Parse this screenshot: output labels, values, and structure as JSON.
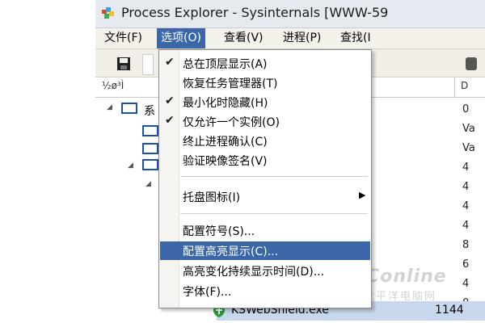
{
  "window": {
    "title": "Process Explorer - Sysinternals [WWW-59"
  },
  "menubar": {
    "items": [
      {
        "label": "文件(F)"
      },
      {
        "label": "选项(O)"
      },
      {
        "label": "查看(V)"
      },
      {
        "label": "进程(P)"
      },
      {
        "label": "查找(I"
      }
    ]
  },
  "columns": {
    "process": "½ø³Ì",
    "pid_fragment": "D"
  },
  "tree": {
    "system_label": "系",
    "pid_fragments": [
      "0",
      "Va",
      "Va",
      "4",
      "4",
      "4",
      "4",
      "8",
      "6",
      "4",
      "0"
    ]
  },
  "process_row": {
    "name": "KSWebShield.exe",
    "pid": "1144"
  },
  "watermark": {
    "main": "PConline",
    "sub": "太平洋电脑网"
  },
  "options_menu": {
    "items": [
      {
        "label": "总在顶层显示(A)",
        "checked": "✔"
      },
      {
        "label": "恢复任务管理器(T)",
        "checked": ""
      },
      {
        "label": "最小化时隐藏(H)",
        "checked": "✔"
      },
      {
        "label": "仅允许一个实例(O)",
        "checked": "✔"
      },
      {
        "label": "终止进程确认(C)",
        "checked": ""
      },
      {
        "label": "验证映像签名(V)",
        "checked": ""
      },
      {
        "label": "托盘图标(I)",
        "checked": "",
        "submenu": "▶"
      },
      {
        "label": "配置符号(S)...",
        "checked": ""
      },
      {
        "label": "配置高亮显示(C)...",
        "checked": ""
      },
      {
        "label": "高亮变化持续显示时间(D)...",
        "checked": ""
      },
      {
        "label": "字体(F)...",
        "checked": ""
      }
    ]
  },
  "colors": {
    "highlight": "#3b67a8",
    "process_box": "#1d4fb0",
    "shield": "#2e9a3a"
  }
}
